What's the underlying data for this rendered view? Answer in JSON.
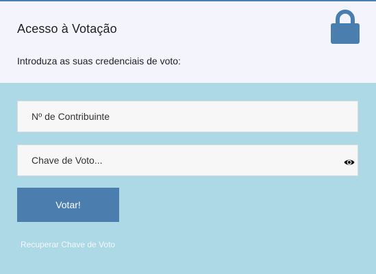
{
  "header": {
    "title": "Acesso à Votação",
    "subtitle": "Introduza as suas credenciais de voto:",
    "icon": "lock-icon"
  },
  "form": {
    "nif_placeholder": "Nº de Contribuinte",
    "nif_value": "",
    "key_placeholder": "Chave de Voto...",
    "key_value": "",
    "show_password_icon": "eye-icon",
    "submit_label": "Votar!",
    "recover_link": "Recuperar Chave de Voto"
  },
  "colors": {
    "header_bg": "#f4f4fd",
    "body_bg": "#add8e6",
    "accent": "#4b7eae",
    "field_bg": "#f7f7f7",
    "link": "#f2f8fb"
  }
}
